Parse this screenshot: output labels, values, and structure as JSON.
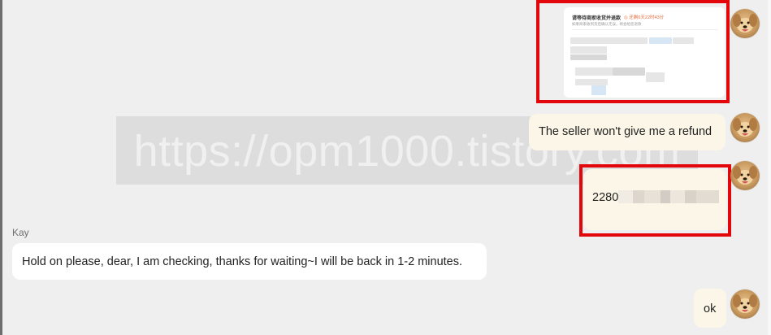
{
  "messages": {
    "screenshot": {
      "title": "请等待商家收货并退款",
      "timer": "◎ 还剩6天22时43分",
      "subtitle": "如果商家收到货后确认无误，将会给您退款"
    },
    "refund_complaint": "The seller won't give me a refund",
    "tracking_number_prefix": "2280",
    "agent_name": "Kay",
    "agent_reply": "Hold on please, dear, I am checking, thanks for waiting~I will be back in 1-2 minutes.",
    "user_ok": "ok"
  },
  "watermark": "https://opm1000.tistory.com",
  "colors": {
    "highlight_box": "#e3060b",
    "user_bubble": "#fbf6e7",
    "agent_bubble": "#ffffff",
    "background": "#efefef"
  }
}
